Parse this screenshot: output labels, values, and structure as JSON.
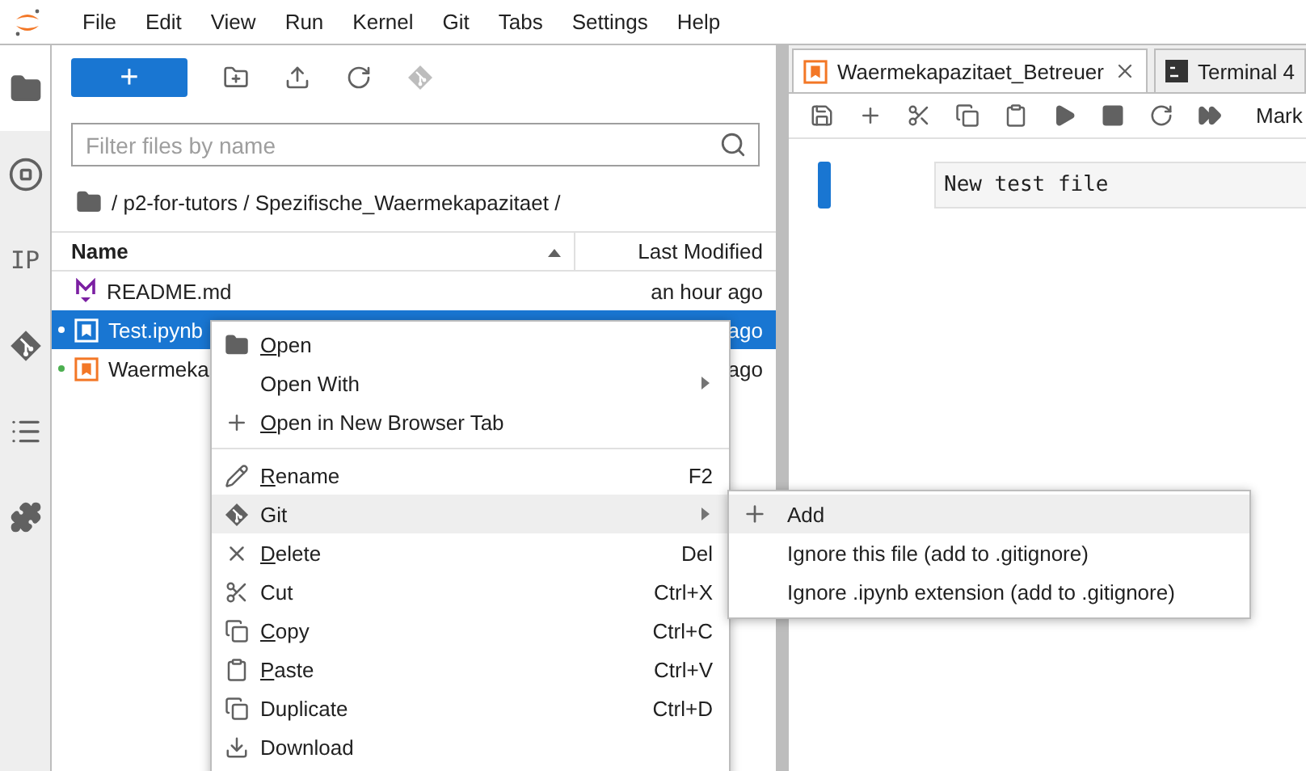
{
  "menu_bar": [
    "File",
    "Edit",
    "View",
    "Run",
    "Kernel",
    "Git",
    "Tabs",
    "Settings",
    "Help"
  ],
  "activity_bar": [
    {
      "kind": "icon",
      "selected": true
    },
    {
      "kind": "icon",
      "selected": false
    },
    {
      "kind": "text",
      "label": "IP",
      "selected": false
    },
    {
      "kind": "icon",
      "selected": false
    },
    {
      "kind": "icon",
      "selected": false
    },
    {
      "kind": "icon",
      "selected": false
    }
  ],
  "file_browser": {
    "new_button": "+",
    "toolbar": [
      {
        "disabled": false
      },
      {
        "disabled": false
      },
      {
        "disabled": false
      },
      {
        "disabled": true
      }
    ],
    "filter": {
      "placeholder": "Filter files by name"
    },
    "breadcrumb": "/ p2-for-tutors / Spezifische_Waermekapazitaet /",
    "columns": [
      "Name",
      "Last Modified"
    ],
    "rows": [
      {
        "kind": "markdown",
        "name": "README.md",
        "modified": "an hour ago",
        "selected": false,
        "running": false
      },
      {
        "kind": "notebook",
        "name": "Test.ipynb",
        "modified": "ago",
        "selected": true,
        "running": true
      },
      {
        "kind": "notebook",
        "name": "Waermeka",
        "modified": "ago",
        "selected": false,
        "running": true
      }
    ]
  },
  "editor": {
    "tabs": [
      {
        "kind": "notebook",
        "label": "Waermekapazitaet_Betreuer",
        "selected": true,
        "closable": true
      },
      {
        "kind": "terminal",
        "label": "Terminal 4",
        "selected": false,
        "closable": false
      }
    ],
    "cell_type": "Mark",
    "cell_text": "New test file",
    "cell_active": true
  },
  "context_menu": [
    {
      "kind": "item",
      "label": "Open",
      "submenu": false,
      "highlighted": false,
      "mnemonic": true
    },
    {
      "kind": "item",
      "label": "Open With",
      "submenu": true,
      "highlighted": false,
      "mnemonic": false
    },
    {
      "kind": "item",
      "label": "Open in New Browser Tab",
      "submenu": false,
      "highlighted": false,
      "mnemonic": true
    },
    {
      "kind": "separator"
    },
    {
      "kind": "item",
      "label": "Rename",
      "shortcut": "F2",
      "submenu": false,
      "highlighted": false,
      "mnemonic": true
    },
    {
      "kind": "item",
      "label": "Git",
      "submenu": true,
      "highlighted": true,
      "mnemonic": false
    },
    {
      "kind": "item",
      "label": "Delete",
      "shortcut": "Del",
      "submenu": false,
      "highlighted": false,
      "mnemonic": true
    },
    {
      "kind": "item",
      "label": "Cut",
      "shortcut": "Ctrl+X",
      "submenu": false,
      "highlighted": false,
      "mnemonic": false
    },
    {
      "kind": "item",
      "label": "Copy",
      "shortcut": "Ctrl+C",
      "submenu": false,
      "highlighted": false,
      "mnemonic": true
    },
    {
      "kind": "item",
      "label": "Paste",
      "shortcut": "Ctrl+V",
      "submenu": false,
      "highlighted": false,
      "mnemonic": true
    },
    {
      "kind": "item",
      "label": "Duplicate",
      "shortcut": "Ctrl+D",
      "submenu": false,
      "highlighted": false,
      "mnemonic": false
    },
    {
      "kind": "item",
      "label": "Download",
      "submenu": false,
      "highlighted": false,
      "mnemonic": false
    }
  ],
  "git_submenu": [
    {
      "label": "Add",
      "highlighted": true
    },
    {
      "label": "Ignore this file (add to .gitignore)",
      "highlighted": false
    },
    {
      "label": "Ignore .ipynb extension (add to .gitignore)",
      "highlighted": false
    }
  ]
}
